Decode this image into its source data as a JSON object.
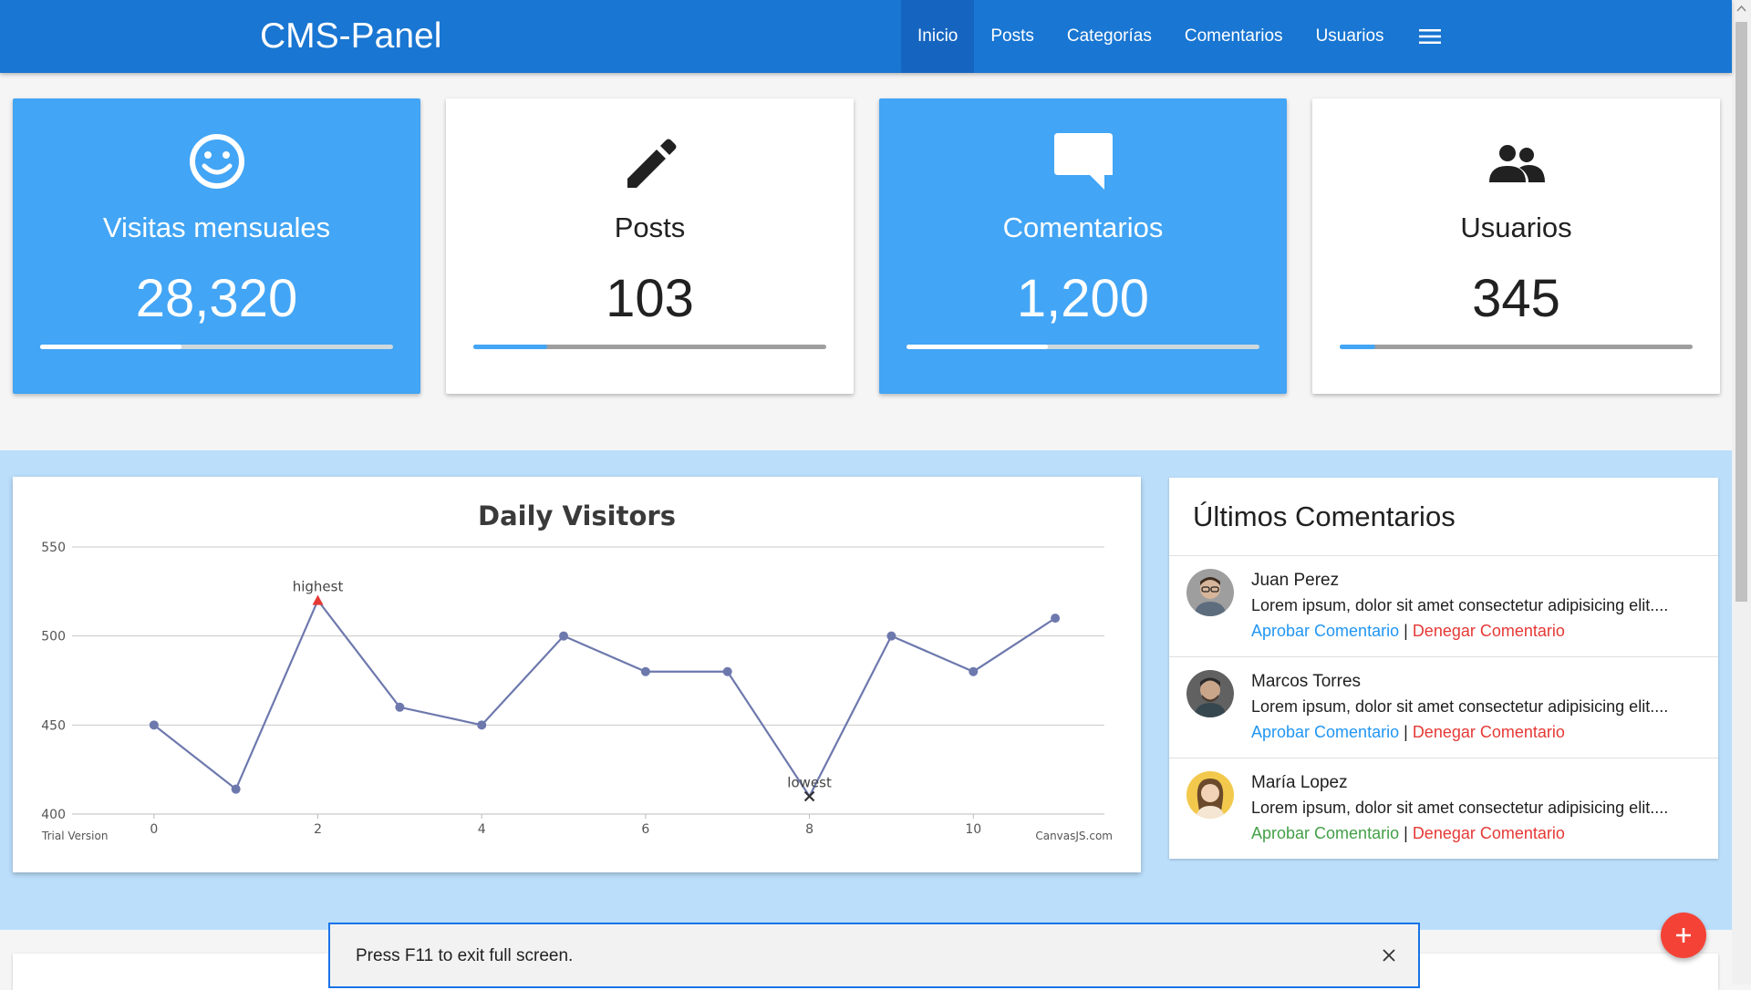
{
  "navbar": {
    "brand": "CMS-Panel",
    "links": [
      {
        "label": "Inicio",
        "active": true
      },
      {
        "label": "Posts",
        "active": false
      },
      {
        "label": "Categorías",
        "active": false
      },
      {
        "label": "Comentarios",
        "active": false
      },
      {
        "label": "Usuarios",
        "active": false
      }
    ],
    "menu_icon": "hamburger-menu-icon",
    "color": "#1976d2"
  },
  "stats": [
    {
      "icon": "smiley-face-icon",
      "title": "Visitas mensuales",
      "value": "28,320",
      "progress": 0.4,
      "style": "blue"
    },
    {
      "icon": "pencil-icon",
      "title": "Posts",
      "value": "103",
      "progress": 0.21,
      "style": "white"
    },
    {
      "icon": "chat-bubble-icon",
      "title": "Comentarios",
      "value": "1,200",
      "progress": 0.4,
      "style": "blue"
    },
    {
      "icon": "users-group-icon",
      "title": "Usuarios",
      "value": "345",
      "progress": 0.1,
      "style": "white"
    }
  ],
  "chart_data": {
    "type": "line",
    "title": "Daily Visitors",
    "x": [
      0,
      1,
      2,
      3,
      4,
      5,
      6,
      7,
      8,
      9,
      10,
      11
    ],
    "series": [
      {
        "values": [
          450,
          414,
          520,
          460,
          450,
          500,
          480,
          480,
          410,
          500,
          480,
          510
        ]
      }
    ],
    "xlim": [
      -1,
      11.6
    ],
    "ylim": [
      400,
      550
    ],
    "x_ticks": [
      0,
      2,
      4,
      6,
      8,
      10
    ],
    "y_ticks": [
      400,
      450,
      500,
      550
    ],
    "grid": true,
    "annotations": [
      {
        "x": 2,
        "label": "highest"
      },
      {
        "x": 8,
        "label": "lowest"
      }
    ],
    "footer_left": "Trial Version",
    "footer_right": "CanvasJS.com",
    "line_color": "#6d78ad"
  },
  "comments": {
    "title": "Últimos Comentarios",
    "approve_label": "Aprobar Comentario",
    "separator": "|",
    "deny_label": "Denegar Comentario",
    "items": [
      {
        "name": "Juan Perez",
        "text": "Lorem ipsum, dolor sit amet consectetur adipisicing elit....",
        "avatar": "avatar-man-glasses",
        "approve_green": false
      },
      {
        "name": "Marcos Torres",
        "text": "Lorem ipsum, dolor sit amet consectetur adipisicing elit....",
        "avatar": "avatar-man-beard",
        "approve_green": false
      },
      {
        "name": "María Lopez",
        "text": "Lorem ipsum, dolor sit amet consectetur adipisicing elit....",
        "avatar": "avatar-woman",
        "approve_green": true
      }
    ]
  },
  "toast": {
    "text": "Press F11 to exit full screen.",
    "close_icon": "close-icon"
  },
  "fab": {
    "icon": "plus-icon",
    "color": "#f44336"
  }
}
